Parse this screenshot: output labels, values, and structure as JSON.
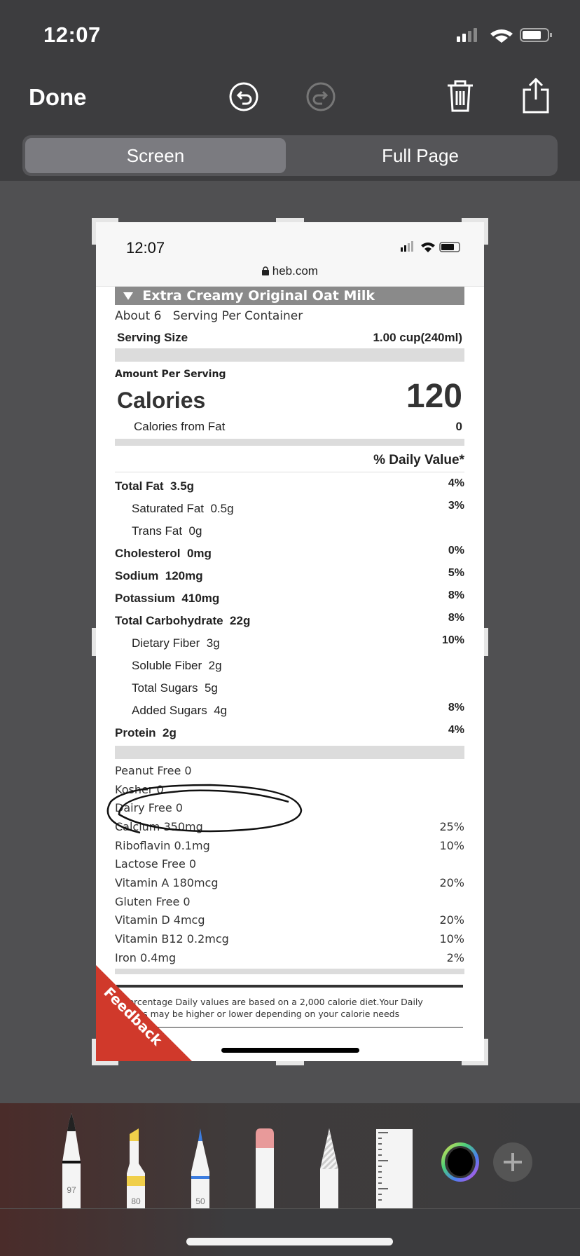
{
  "status": {
    "time": "12:07"
  },
  "header": {
    "done_label": "Done",
    "icons": [
      "undo-icon",
      "redo-icon",
      "trash-icon",
      "share-icon"
    ]
  },
  "segments": {
    "screen": "Screen",
    "full_page": "Full Page",
    "selected": "Screen"
  },
  "screenshot": {
    "status_time": "12:07",
    "url": "heb.com",
    "product_title": "Extra Creamy Original Oat Milk",
    "servings": "About 6   Serving Per Container",
    "serving_size_label": "Serving Size",
    "serving_size_value": "1.00 cup(240ml)",
    "amount_per_serving": "Amount Per Serving",
    "calories_label": "Calories",
    "calories_value": "120",
    "calories_fat_label": "Calories from Fat",
    "calories_fat_value": "0",
    "dv_header": "% Daily Value*",
    "nutrients": [
      {
        "label": "Total Fat  3.5g",
        "dv": "4%",
        "bold": true
      },
      {
        "label": "Saturated Fat  0.5g",
        "dv": "3%",
        "indent": true
      },
      {
        "label": "Trans Fat  0g",
        "dv": "",
        "indent": true
      },
      {
        "label": "Cholesterol  0mg",
        "dv": "0%",
        "bold": true
      },
      {
        "label": "Sodium  120mg",
        "dv": "5%",
        "bold": true
      },
      {
        "label": "Potassium  410mg",
        "dv": "8%",
        "bold": true
      },
      {
        "label": "Total Carbohydrate  22g",
        "dv": "8%",
        "bold": true
      },
      {
        "label": "Dietary Fiber  3g",
        "dv": "10%",
        "indent": true
      },
      {
        "label": "Soluble Fiber  2g",
        "dv": "",
        "indent": true
      },
      {
        "label": "Total Sugars  5g",
        "dv": "",
        "indent": true
      },
      {
        "label": "Added Sugars  4g",
        "dv": "8%",
        "indent": true
      },
      {
        "label": "Protein  2g",
        "dv": "4%",
        "bold": true
      }
    ],
    "other": [
      {
        "label": "Peanut Free 0",
        "dv": ""
      },
      {
        "label": "Kosher 0",
        "dv": ""
      },
      {
        "label": "Dairy Free 0",
        "dv": ""
      },
      {
        "label": "Calcium 350mg",
        "dv": "25%"
      },
      {
        "label": "Riboflavin 0.1mg",
        "dv": "10%"
      },
      {
        "label": "Lactose Free 0",
        "dv": ""
      },
      {
        "label": "Vitamin A 180mcg",
        "dv": "20%"
      },
      {
        "label": "Gluten Free 0",
        "dv": ""
      },
      {
        "label": "Vitamin D 4mcg",
        "dv": "20%"
      },
      {
        "label": "Vitamin B12 0.2mcg",
        "dv": "10%"
      },
      {
        "label": "Iron 0.4mg",
        "dv": "2%"
      }
    ],
    "footnote": "*Percentage Daily values are based on a 2,000 calorie diet.Your Daily values may be higher or lower depending on your calorie needs",
    "feedback_label": "Feedback",
    "feedback_color": "#d0392b"
  },
  "tools": [
    {
      "name": "pen",
      "value": "97"
    },
    {
      "name": "marker",
      "value": "80",
      "color": "#f0cf4a"
    },
    {
      "name": "pencil",
      "value": "50",
      "color": "#3c7de0"
    },
    {
      "name": "eraser",
      "color": "#e89a9a"
    },
    {
      "name": "lasso"
    },
    {
      "name": "ruler"
    }
  ],
  "color_picker": {
    "selected": "#000000"
  }
}
